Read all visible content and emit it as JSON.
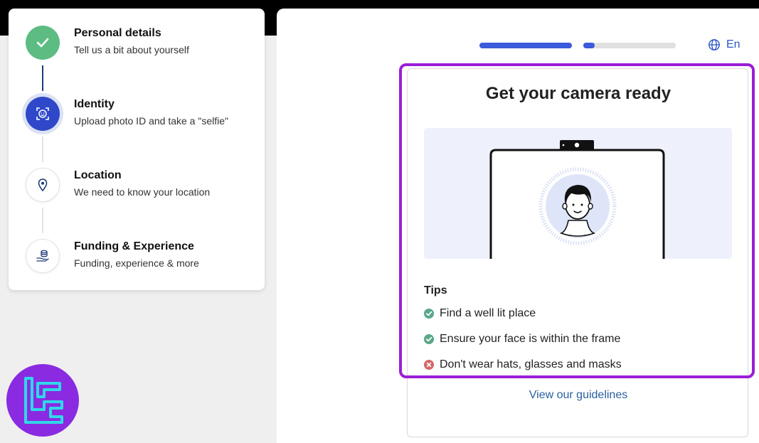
{
  "steps": [
    {
      "title": "Personal details",
      "subtitle": "Tell us a bit about yourself",
      "state": "done",
      "icon": "check-icon"
    },
    {
      "title": "Identity",
      "subtitle": "Upload photo ID and take a \"selfie\"",
      "state": "active",
      "icon": "face-scan-icon"
    },
    {
      "title": "Location",
      "subtitle": "We need to know your location",
      "state": "pending",
      "icon": "location-pin-icon"
    },
    {
      "title": "Funding & Experience",
      "subtitle": "Funding, experience & more",
      "state": "pending",
      "icon": "coins-hand-icon"
    }
  ],
  "progress": {
    "bars": [
      {
        "fraction": 1.0
      },
      {
        "fraction": 0.12
      }
    ],
    "colors": {
      "fill": "#3b5bdb",
      "track": "#e0e0e0"
    }
  },
  "language": {
    "label": "En",
    "icon": "globe-icon"
  },
  "camera_card": {
    "title": "Get your camera ready",
    "tips_title": "Tips",
    "tips": [
      {
        "text": "Find a well lit place",
        "status": "ok"
      },
      {
        "text": "Ensure your face is within the frame",
        "status": "ok"
      },
      {
        "text": "Don't wear hats, glasses and masks",
        "status": "bad"
      }
    ],
    "guidelines_link": "View our guidelines"
  },
  "colors": {
    "done": "#5cbc82",
    "active": "#2f48c9",
    "link": "#2a5fa0",
    "highlight": "#9b1ed6",
    "ok": "#5aa88a",
    "bad": "#d26767"
  }
}
